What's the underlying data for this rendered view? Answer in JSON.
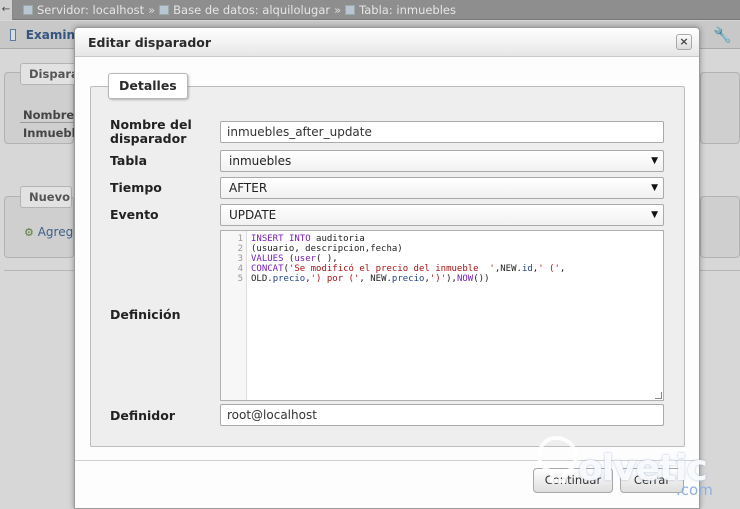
{
  "breadcrumb": {
    "back_label": "←",
    "server": "Servidor: localhost",
    "database": "Base de datos: alquilolugar",
    "table": "Tabla: inmuebles",
    "separator": "»"
  },
  "background": {
    "tab_label": "Examin",
    "fieldset_triggers_legend": "Dispara",
    "col_name": "Nombre",
    "row_value": "Inmueble",
    "fieldset_new_legend": "Nuevo",
    "add_link": "Agreg"
  },
  "dialog": {
    "title": "Editar disparador",
    "close_label": "×",
    "legend": "Detalles",
    "fields": {
      "name_label": "Nombre del disparador",
      "name_value": "inmuebles_after_update",
      "table_label": "Tabla",
      "table_value": "inmuebles",
      "time_label": "Tiempo",
      "time_value": "AFTER",
      "event_label": "Evento",
      "event_value": "UPDATE",
      "definition_label": "Definición",
      "definer_label": "Definidor",
      "definer_value": "root@localhost"
    },
    "definition_lines": [
      "INSERT INTO auditoria",
      "(usuario, descripcion,fecha)",
      "VALUES (user( ),",
      "CONCAT('Se modificó el precio del inmueble  ',NEW.id,' (',",
      "OLD.precio,') por (', NEW.precio,')'),NOW())"
    ],
    "line_numbers": [
      "1",
      "2",
      "3",
      "4",
      "5"
    ],
    "buttons": {
      "continue": "Continuar",
      "cancel": "Cerrar"
    }
  },
  "watermark": {
    "brand": "olvetic",
    "suffix": ".com"
  },
  "colors": {
    "dialog_background": "#fdfdfd",
    "keyword": "#771fb3",
    "string": "#aa1111",
    "link": "#3e5f8a"
  }
}
